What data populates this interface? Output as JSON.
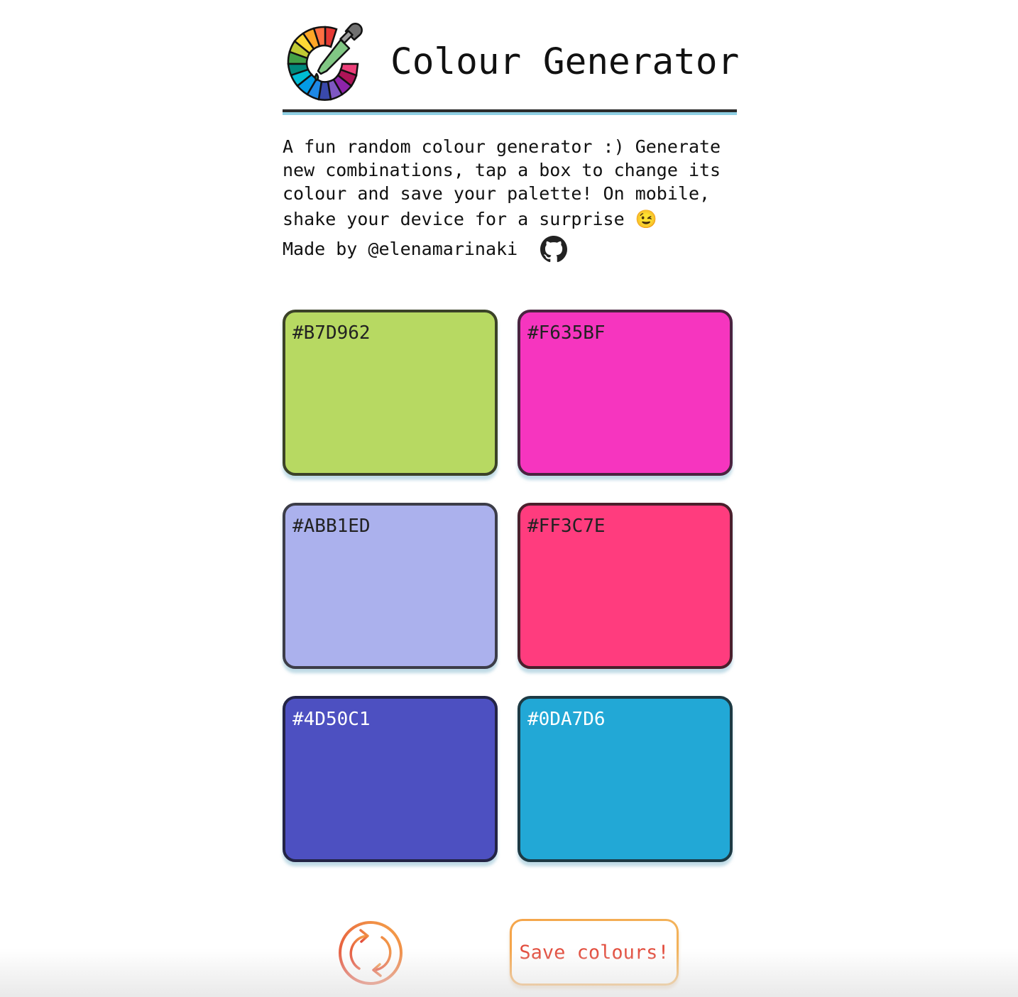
{
  "header": {
    "title": "Colour Generator"
  },
  "intro": {
    "line1": "A fun random colour generator :) Generate",
    "line2": "new combinations, tap a box to change its",
    "line3": "colour and save your palette! On mobile,",
    "line4": "shake your device for a surprise 😉",
    "made_by": "Made by @elenamarinaki"
  },
  "icons": {
    "logo": "colour-wheel-dropper-icon",
    "github": "github-icon",
    "refresh": "refresh-icon"
  },
  "swatches": [
    {
      "hex": "#B7D962",
      "fill": "#B7D962",
      "border": "#3b4228",
      "text": "#222222"
    },
    {
      "hex": "#F635BF",
      "fill": "#F635BF",
      "border": "#4a2340",
      "text": "#222222"
    },
    {
      "hex": "#ABB1ED",
      "fill": "#ABB1ED",
      "border": "#3c3d48",
      "text": "#222222"
    },
    {
      "hex": "#FF3C7E",
      "fill": "#FF3C7E",
      "border": "#4a1f2c",
      "text": "#222222"
    },
    {
      "hex": "#4D50C1",
      "fill": "#4D50C1",
      "border": "#232445",
      "text": "#ffffff"
    },
    {
      "hex": "#0DA7D6",
      "fill": "#22A8D6",
      "border": "#1d3a44",
      "text": "#ffffff"
    }
  ],
  "actions": {
    "save_label": "Save colours!"
  }
}
